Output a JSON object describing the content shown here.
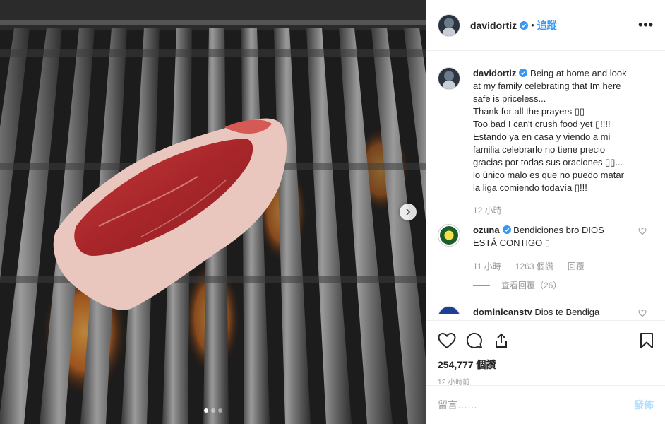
{
  "post": {
    "username": "davidortiz",
    "follow_label": "追蹤",
    "separator": "•",
    "more_label": "•••",
    "verified_icon": "verified-badge-icon"
  },
  "caption": {
    "username": "davidortiz",
    "lines": [
      " Being at home and look",
      "at my family celebrating that Im here",
      "safe is priceless...",
      "Thank for all the prayers ▯▯",
      "Too bad I can't crush food yet ▯!!!!",
      "Estando ya en casa y viendo a mi",
      "familia celebrarlo no tiene precio",
      "gracias por todas sus oraciones ▯▯...",
      "lo único malo es que no puedo matar",
      "la liga comiendo todavía ▯!!!"
    ],
    "time": "12 小時"
  },
  "comments": [
    {
      "username": "ozuna",
      "text_line1": " Bendiciones bro DIOS",
      "text_line2": "ESTÁ CONTIGO ▯",
      "time": "11 小時",
      "likes": "1263 個讚",
      "reply_label": "回覆",
      "view_replies": "查看回覆（26）"
    },
    {
      "username": "dominicanstv",
      "text": " Dios te Bendiga"
    }
  ],
  "actions": {
    "likes": "254,777 個讚",
    "posted": "12 小時前"
  },
  "add_comment": {
    "placeholder": "留言……",
    "post_label": "發佈"
  },
  "colors": {
    "link": "#3897f0",
    "verified": "#3897f0",
    "muted": "#999999",
    "post_disabled": "#b2dffc"
  },
  "carousel": {
    "current": 1,
    "total": 3
  }
}
